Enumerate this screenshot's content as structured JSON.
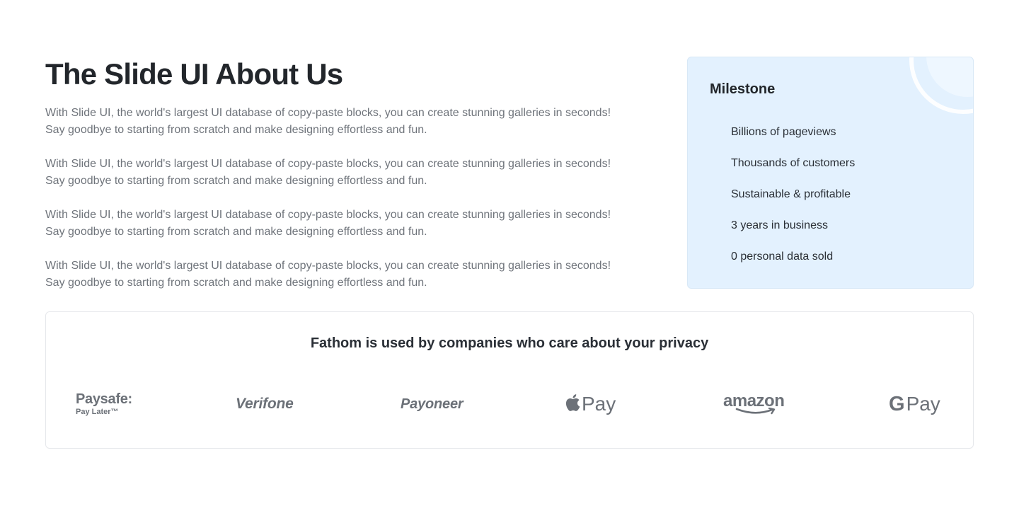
{
  "about": {
    "title": "The Slide UI About Us",
    "paragraphs": [
      "With Slide UI, the world's largest UI database of copy-paste blocks, you can create stunning galleries in seconds!\nSay goodbye to starting from scratch and make designing effortless and fun.",
      "With Slide UI, the world's largest UI database of copy-paste blocks, you can create stunning galleries in seconds!\nSay goodbye to starting from scratch and make designing effortless and fun.",
      "With Slide UI, the world's largest UI database of copy-paste blocks, you can create stunning galleries in seconds!\nSay goodbye to starting from scratch and make designing effortless and fun.",
      "With Slide UI, the world's largest UI database of copy-paste blocks, you can create stunning galleries in seconds!\nSay goodbye to starting from scratch and make designing effortless and fun."
    ]
  },
  "milestone": {
    "title": "Milestone",
    "items": [
      "Billions of pageviews",
      "Thousands of customers",
      "Sustainable & profitable",
      "3 years in business",
      "0 personal data sold"
    ],
    "background_color": "#e3f1fe"
  },
  "companies": {
    "heading": "Fathom is used by companies who care about your privacy",
    "logos": {
      "paysafe": {
        "main": "Paysafe:",
        "sub": "Pay Later™"
      },
      "verifone": "Verifone",
      "payoneer": "Payoneer",
      "applepay": {
        "icon": "apple-icon",
        "text": "Pay"
      },
      "amazon": "amazon",
      "gpay": {
        "g": "G",
        "text": "Pay"
      }
    },
    "logo_color": "#6c7178"
  }
}
